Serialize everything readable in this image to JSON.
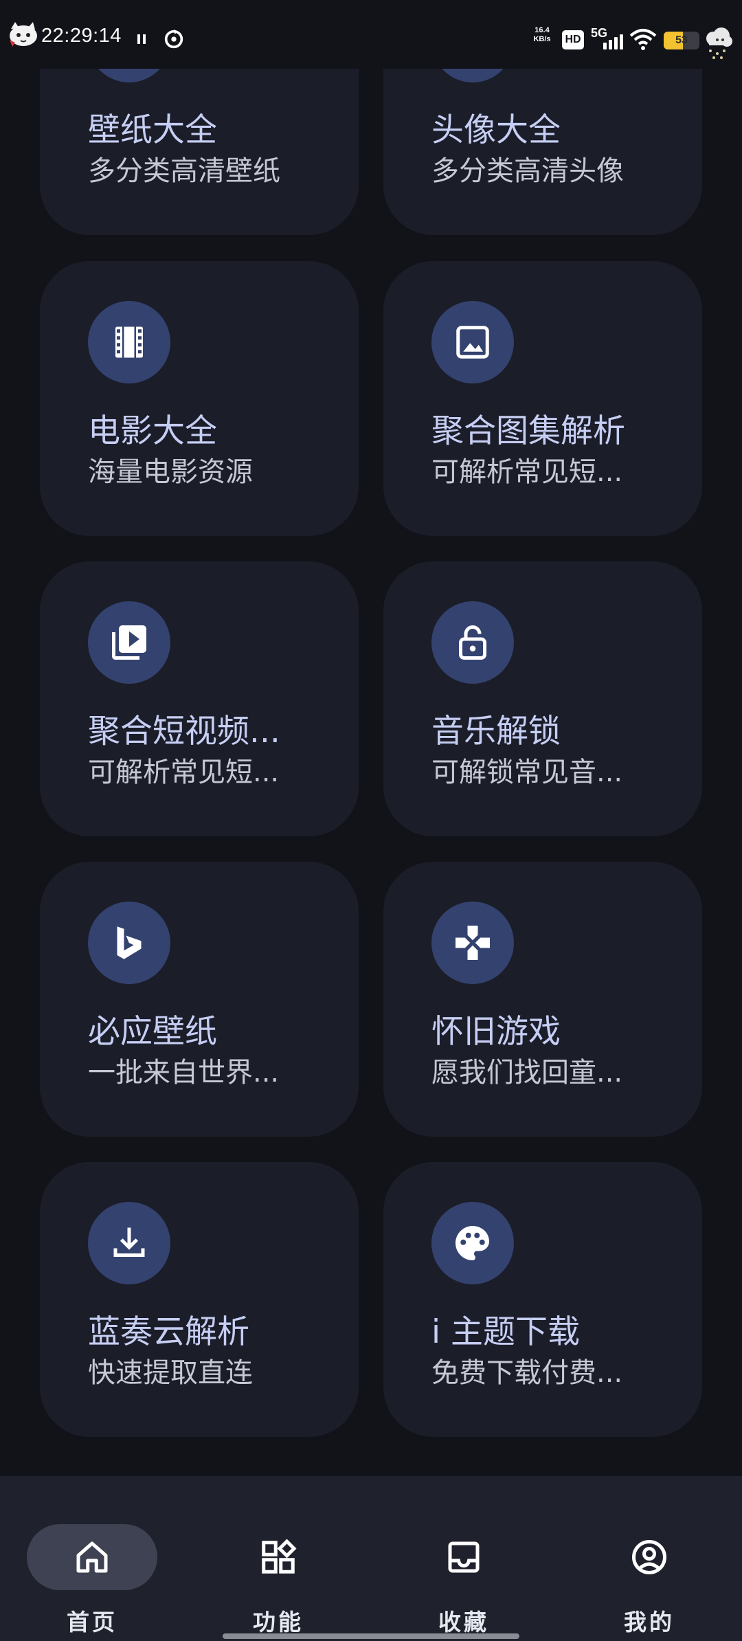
{
  "status_bar": {
    "time": "22:29:14",
    "net_speed_value": "16.4",
    "net_speed_unit": "KB/s",
    "hd_label": "HD",
    "network_type": "5G",
    "battery_level": "53",
    "battery_fraction": 0.53,
    "icons": [
      "mascot-icon",
      "pause-icon",
      "sync-icon",
      "signal-icon",
      "wifi-icon",
      "battery-icon",
      "weather-icon"
    ]
  },
  "cards": [
    {
      "title": "壁纸大全",
      "subtitle": "多分类高清壁纸",
      "icon": "wallpaper-icon"
    },
    {
      "title": "头像大全",
      "subtitle": "多分类高清头像",
      "icon": "avatar-icon"
    },
    {
      "title": "电影大全",
      "subtitle": "海量电影资源",
      "icon": "film-icon"
    },
    {
      "title": "聚合图集解析",
      "subtitle": "可解析常见短...",
      "icon": "image-icon"
    },
    {
      "title": "聚合短视频...",
      "subtitle": "可解析常见短...",
      "icon": "video-library-icon"
    },
    {
      "title": "音乐解锁",
      "subtitle": "可解锁常见音...",
      "icon": "unlock-icon"
    },
    {
      "title": "必应壁纸",
      "subtitle": "一批来自世界...",
      "icon": "bing-icon"
    },
    {
      "title": "怀旧游戏",
      "subtitle": "愿我们找回童...",
      "icon": "gamepad-icon"
    },
    {
      "title": "蓝奏云解析",
      "subtitle": "快速提取直连",
      "icon": "download-icon"
    },
    {
      "title": "i 主题下载",
      "subtitle": "免费下载付费...",
      "icon": "palette-icon"
    }
  ],
  "bottom_nav": {
    "items": [
      {
        "label": "首页",
        "icon": "home-icon",
        "active": true
      },
      {
        "label": "功能",
        "icon": "apps-icon",
        "active": false
      },
      {
        "label": "收藏",
        "icon": "inbox-icon",
        "active": false
      },
      {
        "label": "我的",
        "icon": "account-icon",
        "active": false
      }
    ]
  },
  "colors": {
    "background": "#111319",
    "card": "#1b1d29",
    "icon_circle": "#34426f",
    "title_text": "#c6cef3",
    "nav_background": "#1f212c",
    "nav_active_pill": "#3e4252",
    "battery": "#f2c230"
  }
}
